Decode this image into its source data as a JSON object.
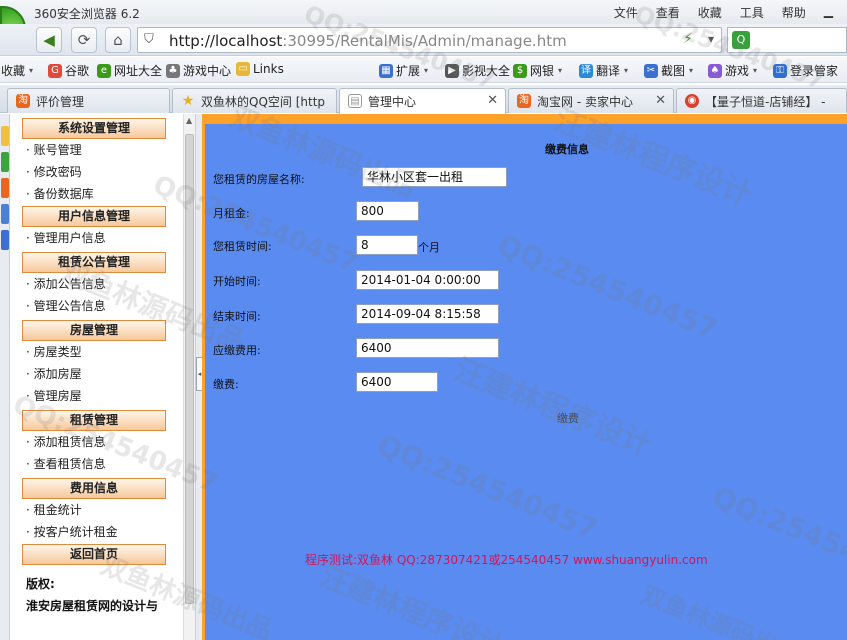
{
  "browser": {
    "title": "360安全浏览器 6.2",
    "menu": [
      "文件",
      "查看",
      "收藏",
      "工具",
      "帮助"
    ],
    "url_host": "http://localhost",
    "url_rest": ":30995/RentalMis/Admin/manage.htm"
  },
  "favbar": {
    "items": [
      "收藏",
      "谷歌",
      "网址大全",
      "游戏中心",
      "Links",
      "扩展",
      "影视大全",
      "网银",
      "翻译",
      "截图",
      "游戏",
      "登录管家"
    ]
  },
  "tabs": [
    {
      "label": "评价管理"
    },
    {
      "label": "双鱼林的QQ空间 [http"
    },
    {
      "label": "管理中心"
    },
    {
      "label": "淘宝网 - 卖家中心"
    },
    {
      "label": "【量子恒道-店铺经】 -"
    }
  ],
  "sidebar": {
    "groups": [
      {
        "title": "系统设置管理",
        "items": [
          "账号管理",
          "修改密码",
          "备份数据库"
        ]
      },
      {
        "title": "用户信息管理",
        "items": [
          "管理用户信息"
        ]
      },
      {
        "title": "租赁公告管理",
        "items": [
          "添加公告信息",
          "管理公告信息"
        ]
      },
      {
        "title": "房屋管理",
        "items": [
          "房屋类型",
          "添加房屋",
          "管理房屋"
        ]
      },
      {
        "title": "租赁管理",
        "items": [
          "添加租赁信息",
          "查看租赁信息"
        ]
      },
      {
        "title": "费用信息",
        "items": [
          "租金统计",
          "按客户统计租金"
        ]
      }
    ],
    "home": "返回首页",
    "copyright_label": "版权:",
    "copyright_text": "淮安房屋租赁网的设计与"
  },
  "form": {
    "title": "缴费信息",
    "house_name_label": "您租赁的房屋名称:",
    "house_name": "华林小区套一出租",
    "monthly_rent_label": "月租金:",
    "monthly_rent": "800",
    "duration_label": "您租赁时间:",
    "duration": "8",
    "duration_unit": "个月",
    "start_label": "开始时间:",
    "start": "2014-01-04 0:00:00",
    "end_label": "结束时间:",
    "end": "2014-09-04 8:15:58",
    "due_label": "应缴费用:",
    "due": "6400",
    "pay_label": "缴费:",
    "pay": "6400",
    "pay_button": "缴费"
  },
  "footer": "程序测试:双鱼林 QQ:287307421或254540457 www.shuangyulin.com",
  "watermarks": {
    "qq": "QQ:254540457",
    "design": "汪建林程序设计",
    "source": "双鱼林源码出品"
  }
}
